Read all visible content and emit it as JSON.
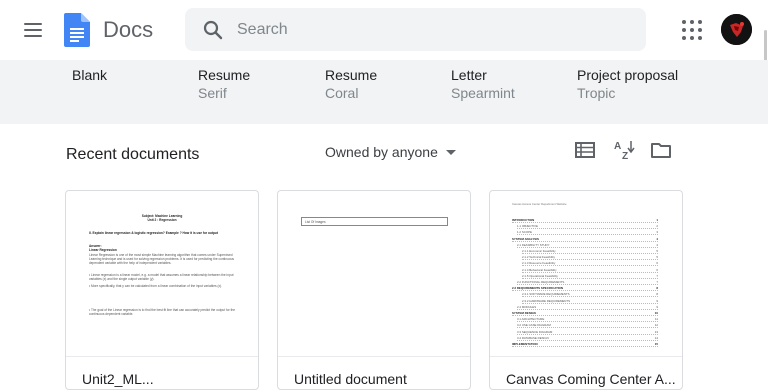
{
  "header": {
    "app_name": "Docs",
    "search_placeholder": "Search",
    "brand_color": "#4285f4"
  },
  "templates": [
    {
      "name": "Blank",
      "subtitle": ""
    },
    {
      "name": "Resume",
      "subtitle": "Serif"
    },
    {
      "name": "Resume",
      "subtitle": "Coral"
    },
    {
      "name": "Letter",
      "subtitle": "Spearmint"
    },
    {
      "name": "Project proposal",
      "subtitle": "Tropic"
    }
  ],
  "recent": {
    "title": "Recent documents",
    "owner_filter": "Owned by anyone",
    "icons": [
      "list-view-icon",
      "sort-az-icon",
      "folder-icon"
    ]
  },
  "documents": [
    {
      "title": "Unit2_ML...",
      "thumb": {
        "heading1": "Subject: Machine Learning",
        "heading2": "Unit 2 : Regression",
        "question": "II. Explain linear regression & logistic regression? Example ? How it is use for output",
        "answer_label": "Answer:",
        "section": "Linear Regression",
        "para1": "Linear Regression is one of the most simple Machine learning algorithm that comes under Supervised Learning technique and is used for solving regression problems. It is used for predicting the continuous dependent variable with the help of independent variables.",
        "para2": "• Linear regression is a linear model, e.g. a model that assumes a linear relationship between the input variables (x) and the single output variable (y).",
        "para3": "• More specifically, that y can be calculated from a linear combination of the input variables (x).",
        "para4": "• The goal of the Linear regression is to find the best fit line that can accurately predict the output for the continuous dependent variable."
      }
    },
    {
      "title": "Untitled document",
      "thumb": {
        "field": "List Of Images"
      }
    },
    {
      "title": "Canvas Coming Center A...",
      "thumb": {
        "header": "Canvas Access Center Department Website",
        "toc": [
          {
            "text": "INTRODUCTION",
            "page": "1",
            "level": 0
          },
          {
            "text": "1.1 OBJECTIVE",
            "page": "2",
            "level": 1
          },
          {
            "text": "1.2 SCOPE",
            "page": "3",
            "level": 1
          },
          {
            "text": "SYSTEM ANALYSIS",
            "page": "4",
            "level": 0
          },
          {
            "text": "2.1 FEASIBILITY STUDY",
            "page": "4",
            "level": 1
          },
          {
            "text": "2.1.1 Economic Feasibility",
            "page": "5",
            "level": 2
          },
          {
            "text": "2.1.2 Technical Feasibility",
            "page": "5",
            "level": 2
          },
          {
            "text": "2.1.3 Resource Feasibility",
            "page": "6",
            "level": 2
          },
          {
            "text": "2.1.4 Behavioral Feasibility",
            "page": "6",
            "level": 2
          },
          {
            "text": "2.1.5 Operational Feasibility",
            "page": "7",
            "level": 2
          },
          {
            "text": "2.2 FUNCTIONAL REQUIREMENTS",
            "page": "7",
            "level": 1
          },
          {
            "text": "2.3 REQUIREMENTS SPECIFICATION",
            "page": "8",
            "level": 0
          },
          {
            "text": "2.3.1 SOFTWARE REQUIREMENTS",
            "page": "8",
            "level": 2
          },
          {
            "text": "2.3.2 HARDWARE REQUIREMENTS",
            "page": "9",
            "level": 2
          },
          {
            "text": "2.4 MODULES",
            "page": "9",
            "level": 1
          },
          {
            "text": "SYSTEM DESIGN",
            "page": "10",
            "level": 0
          },
          {
            "text": "3.1 ARCHITECTURE",
            "page": "11",
            "level": 1
          },
          {
            "text": "3.2 USE CASE DIAGRAM",
            "page": "12",
            "level": 1
          },
          {
            "text": "3.3 SEQUENCE DIAGRAM",
            "page": "13",
            "level": 1
          },
          {
            "text": "3.4 DATABASE DESIGN",
            "page": "14",
            "level": 1
          },
          {
            "text": "IMPLEMENTATION",
            "page": "15",
            "level": 0
          }
        ]
      }
    }
  ]
}
